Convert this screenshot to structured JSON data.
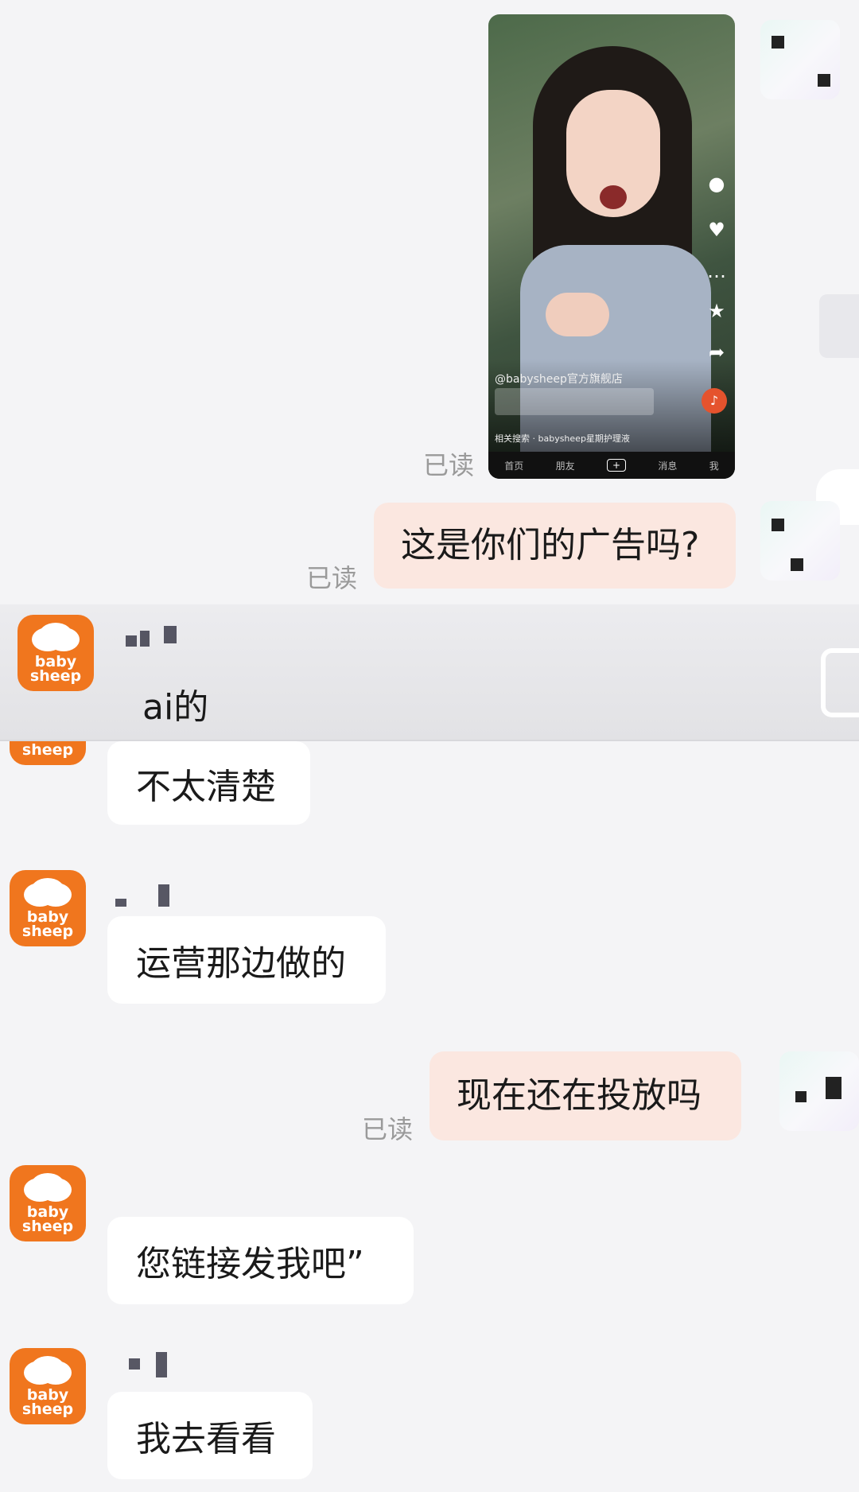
{
  "messages": {
    "video": {
      "account": "@babysheep官方旗舰店",
      "search": "相关搜索 · babysheep星期护理液"
    },
    "read_1": "已读",
    "m1": {
      "text": "这是你们的广告吗?",
      "read": "已读"
    },
    "m2": {
      "text": "ai的"
    },
    "m3": {
      "text": "不太清楚"
    },
    "m4": {
      "text": "运营那边做的"
    },
    "m5": {
      "text": "现在还在投放吗",
      "read": "已读"
    },
    "m6": {
      "text": "您链接发我吧”"
    },
    "m7": {
      "text": "我去看看"
    }
  },
  "avatar": {
    "brand_line1": "baby",
    "brand_line2": "sheep"
  },
  "video_tabs": [
    "首页",
    "朋友",
    "+",
    "消息",
    "我"
  ],
  "colors": {
    "brand": "#f0761e",
    "self_bubble": "#fbe7e0",
    "other_bubble": "#ffffff"
  }
}
